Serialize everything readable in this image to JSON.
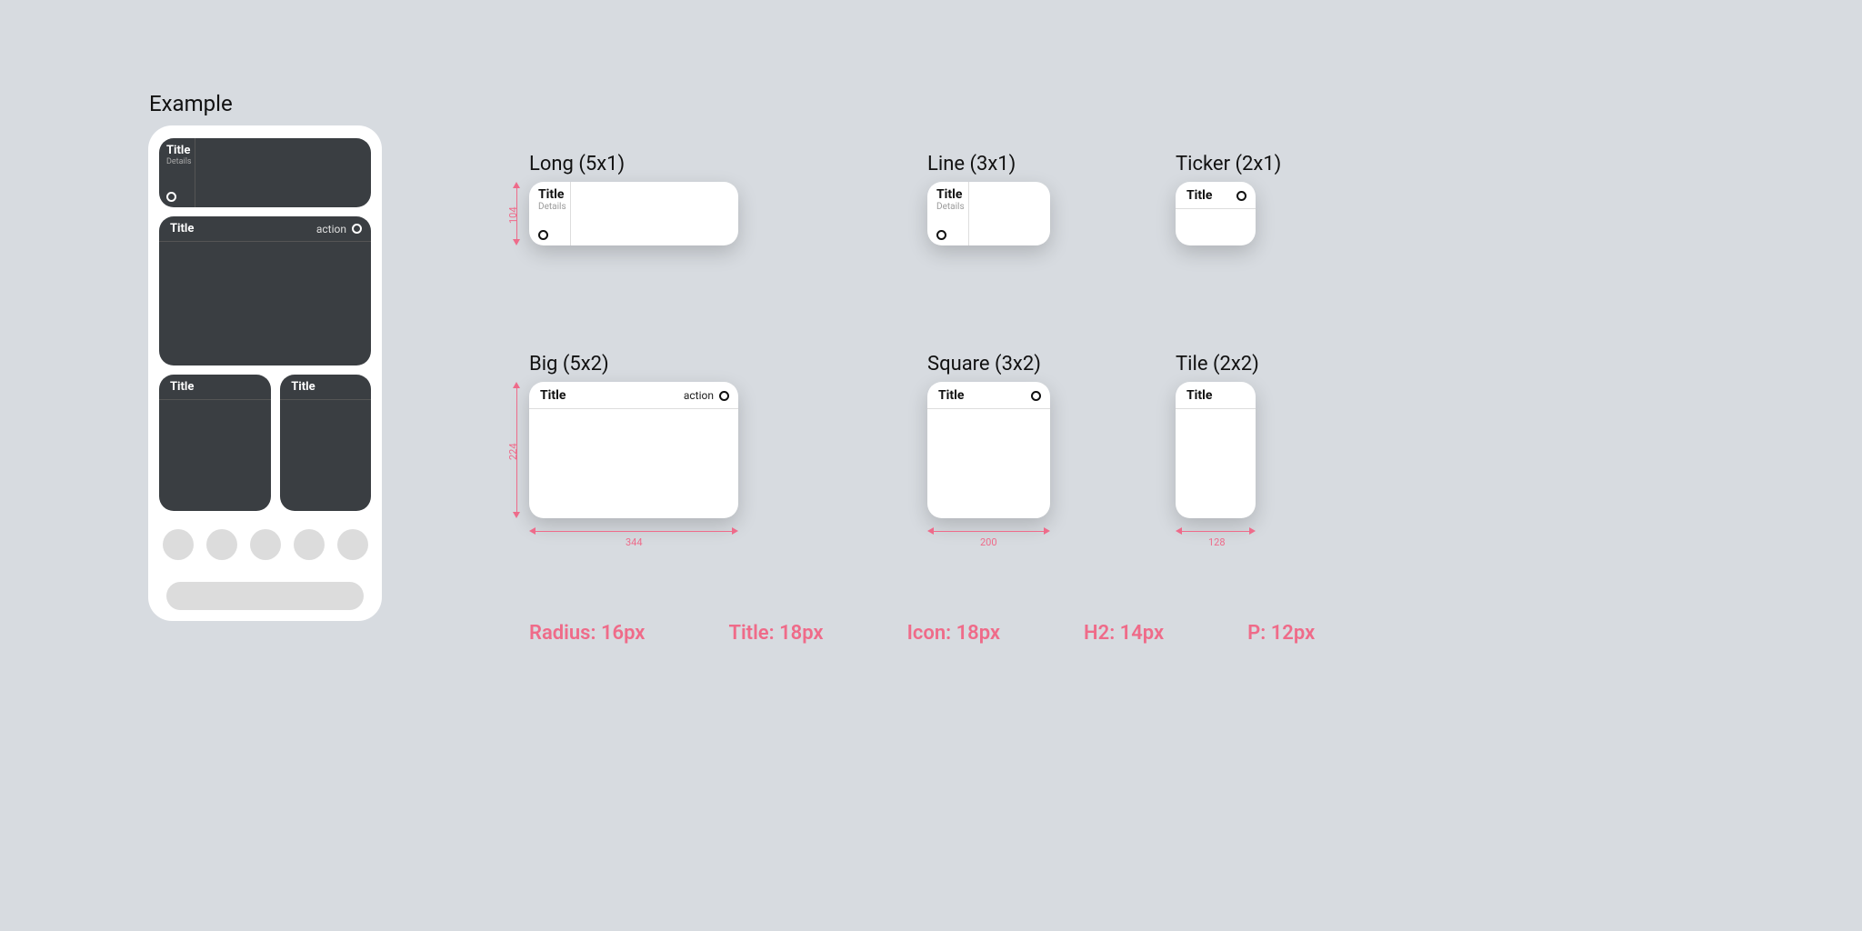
{
  "example_label": "Example",
  "generic": {
    "title": "Title",
    "details": "Details",
    "action": "action"
  },
  "widgets": {
    "long": {
      "label": "Long (5x1)"
    },
    "line": {
      "label": "Line (3x1)"
    },
    "ticker": {
      "label": "Ticker (2x1)"
    },
    "big": {
      "label": "Big (5x2)"
    },
    "square": {
      "label": "Square (3x2)"
    },
    "tile": {
      "label": "Tile (2x2)"
    }
  },
  "dimensions": {
    "h_small": "104",
    "h_big": "224",
    "w_big": "344",
    "w_square": "200",
    "w_tile": "128"
  },
  "specs": {
    "radius": "Radius: 16px",
    "title": "Title: 18px",
    "icon": "Icon: 18px",
    "h2": "H2: 14px",
    "p": "P: 12px"
  }
}
